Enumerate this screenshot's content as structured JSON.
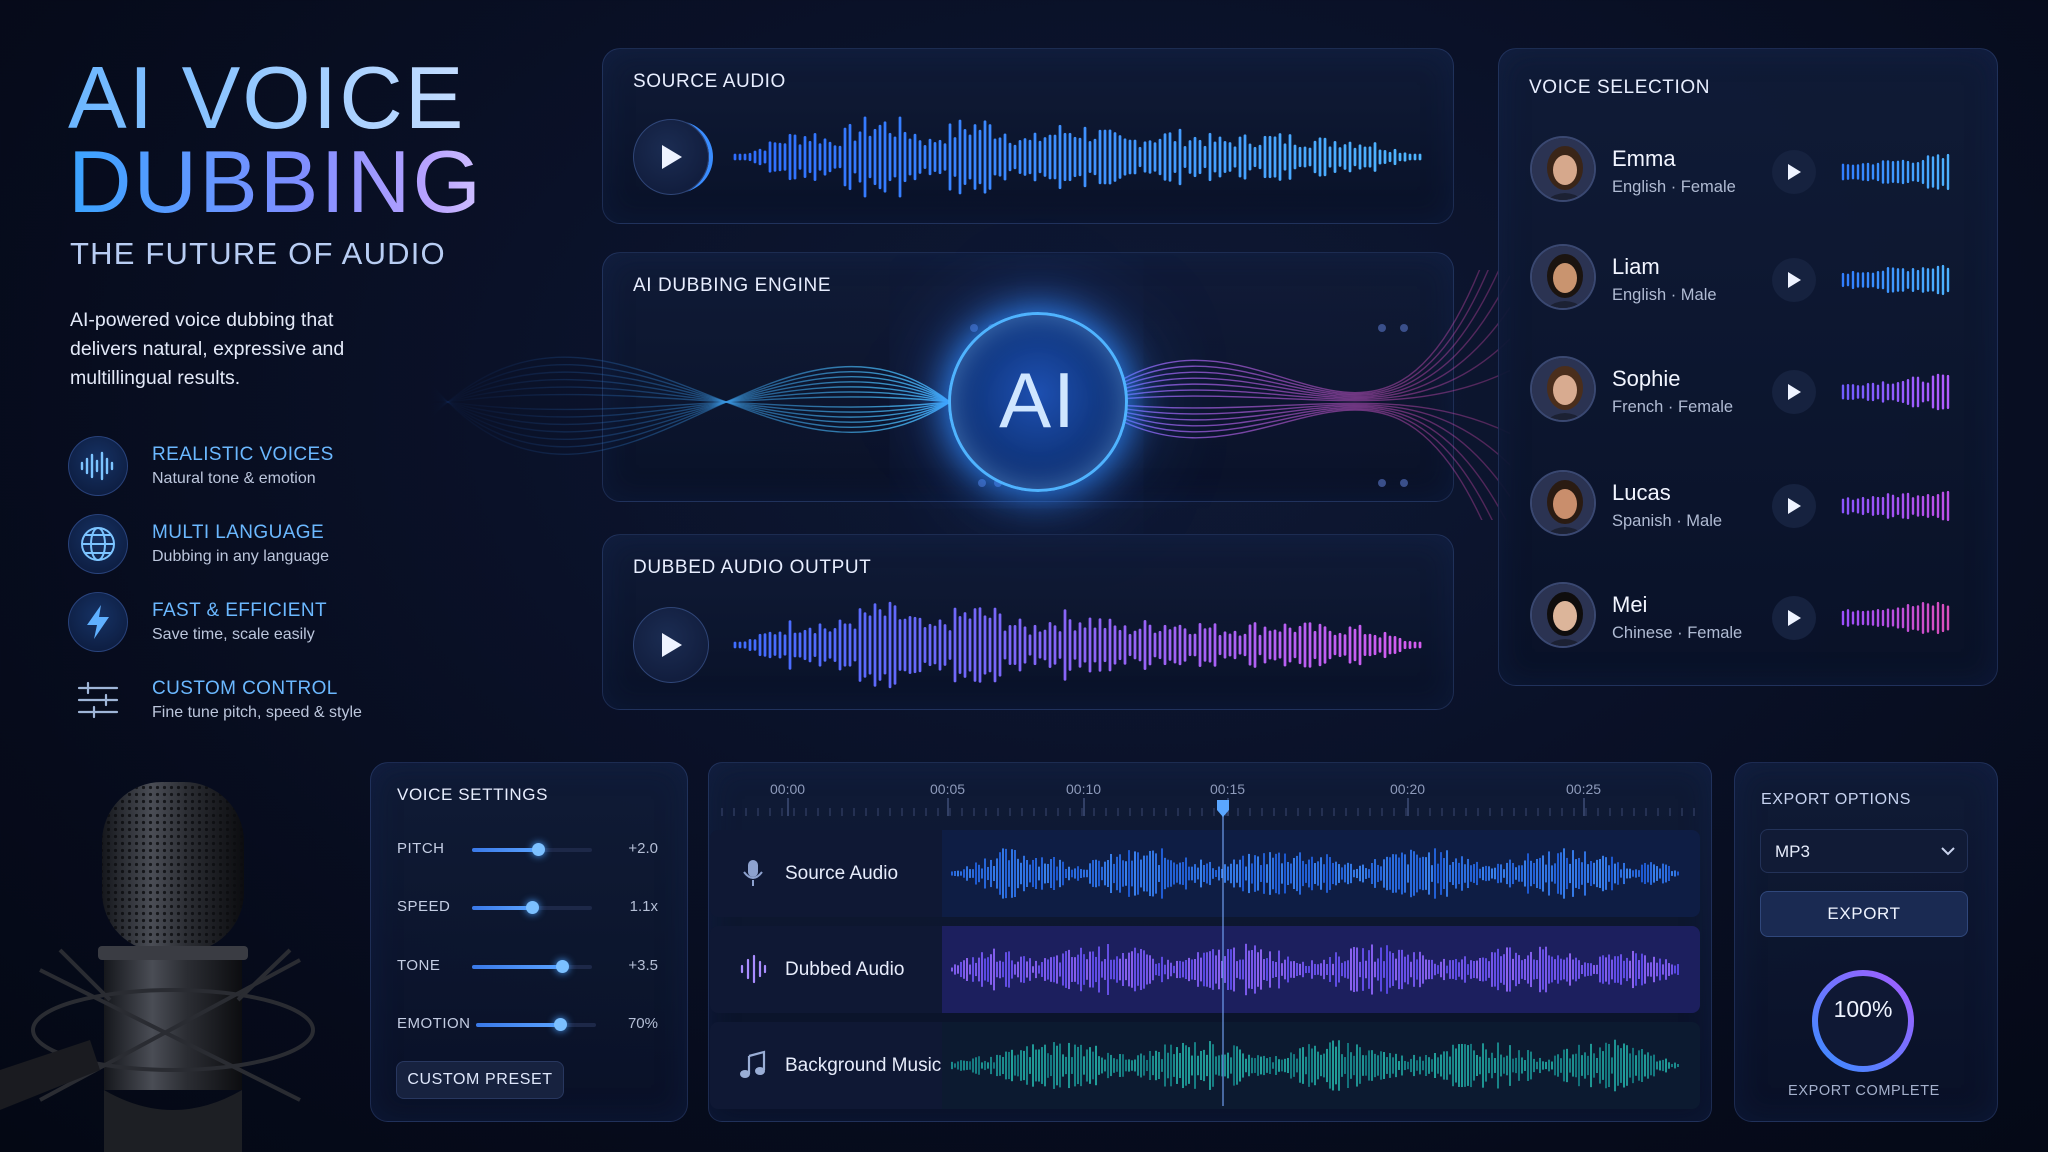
{
  "hero": {
    "title_line1": "AI VOICE",
    "title_line2": "DUBBING",
    "subtitle": "THE FUTURE OF AUDIO",
    "description": "AI-powered voice dubbing that delivers natural, expressive and multillingual results."
  },
  "features": [
    {
      "icon": "waveform-icon",
      "title": "REALISTIC VOICES",
      "desc": "Natural tone & emotion"
    },
    {
      "icon": "globe-icon",
      "title": "MULTI LANGUAGE",
      "desc": "Dubbing in any language"
    },
    {
      "icon": "lightning-icon",
      "title": "FAST & EFFICIENT",
      "desc": "Save time, scale easily"
    },
    {
      "icon": "sliders-icon",
      "title": "CUSTOM CONTROL",
      "desc": "Fine tune pitch, speed & style"
    }
  ],
  "source_audio": {
    "title": "SOURCE AUDIO"
  },
  "engine": {
    "title": "AI DUBBING ENGINE",
    "core_label": "AI"
  },
  "dubbed_output": {
    "title": "DUBBED AUDIO OUTPUT"
  },
  "voice_selection": {
    "title": "VOICE SELECTION",
    "voices": [
      {
        "name": "Emma",
        "meta": "English · Female"
      },
      {
        "name": "Liam",
        "meta": "English · Male"
      },
      {
        "name": "Sophie",
        "meta": "French · Female"
      },
      {
        "name": "Lucas",
        "meta": "Spanish · Male"
      },
      {
        "name": "Mei",
        "meta": "Chinese · Female"
      }
    ]
  },
  "voice_settings": {
    "title": "VOICE SETTINGS",
    "sliders": [
      {
        "label": "PITCH",
        "value": "+2.0",
        "level": 0.55
      },
      {
        "label": "SPEED",
        "value": "1.1x",
        "level": 0.5
      },
      {
        "label": "TONE",
        "value": "+3.5",
        "level": 0.75
      },
      {
        "label": "EMOTION",
        "value": "70%",
        "level": 0.7
      }
    ],
    "preset_button": "CUSTOM PRESET"
  },
  "timeline": {
    "ticks": [
      "00:00",
      "00:05",
      "00:10",
      "00:15",
      "00:20",
      "00:25"
    ],
    "playhead": "00:15",
    "tracks": [
      {
        "name": "Source Audio",
        "icon": "microphone-icon",
        "color": "#2f7dff"
      },
      {
        "name": "Dubbed Audio",
        "icon": "waveform-icon",
        "color": "#7a5cff"
      },
      {
        "name": "Background Music",
        "icon": "music-note-icon",
        "color": "#1f9aa0"
      }
    ]
  },
  "export": {
    "title": "EXPORT OPTIONS",
    "format": "MP3",
    "button": "EXPORT",
    "progress": 1.0,
    "progress_label": "100%",
    "status": "EXPORT COMPLETE"
  },
  "colors": {
    "accent_blue": "#3a8dff",
    "accent_purple": "#8a5cff",
    "accent_pink": "#e04fd0",
    "background": "#0a1128"
  }
}
